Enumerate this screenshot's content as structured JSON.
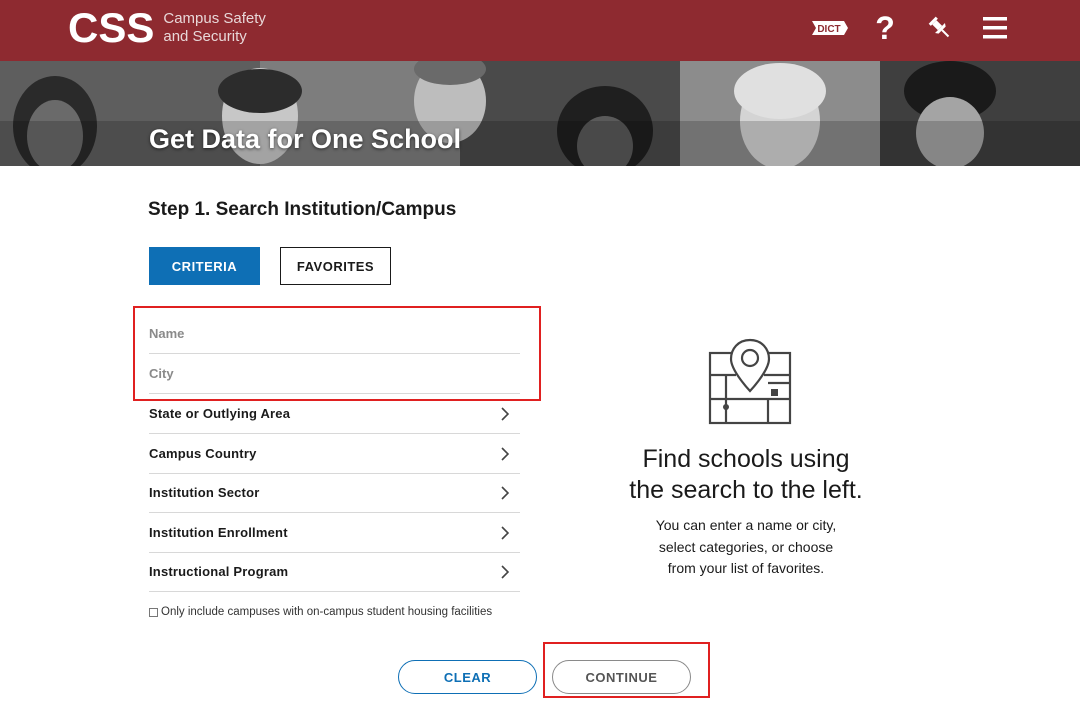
{
  "header": {
    "logo_mark": "CSS",
    "logo_line1": "Campus Safety",
    "logo_line2": "and Security",
    "icons": [
      "dictionary-icon",
      "help-icon",
      "pin-icon",
      "menu-icon"
    ],
    "help_glyph": "?",
    "dict_label": "DICT",
    "brand_color": "#8e2a30"
  },
  "hero": {
    "title": "Get Data for One School"
  },
  "step": {
    "title": "Step 1. Search Institution/Campus"
  },
  "tabs": {
    "criteria": "CRITERIA",
    "favorites": "FAVORITES",
    "active_color": "#0e6fb5"
  },
  "fields": {
    "name_placeholder": "Name",
    "name_value": "",
    "city_placeholder": "City",
    "city_value": ""
  },
  "categories": [
    "State or Outlying Area",
    "Campus Country",
    "Institution Sector",
    "Institution Enrollment",
    "Instructional Program"
  ],
  "housing_label": "Only include campuses with on-campus student housing facilities",
  "buttons": {
    "clear": "CLEAR",
    "continue": "CONTINUE"
  },
  "info": {
    "title_line1": "Find schools using",
    "title_line2": "the search to the left.",
    "text_line1": "You can enter a name or city,",
    "text_line2": "select categories, or choose",
    "text_line3": "from your list of favorites."
  }
}
